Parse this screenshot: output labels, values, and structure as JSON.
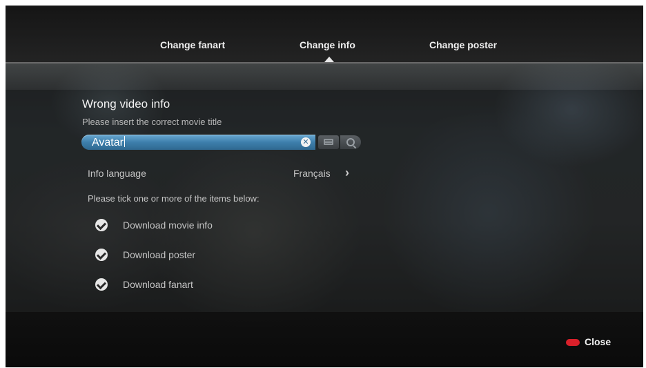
{
  "tabs": [
    {
      "label": "Change fanart",
      "active": false
    },
    {
      "label": "Change info",
      "active": true
    },
    {
      "label": "Change poster",
      "active": false
    }
  ],
  "dialog": {
    "title": "Wrong video info",
    "subtitle": "Please insert the correct movie title",
    "search": {
      "value": "Avatar"
    },
    "info_language": {
      "label": "Info language",
      "value": "Français"
    },
    "instruction": "Please tick one or more of the items below:",
    "options": [
      {
        "label": "Download movie info",
        "checked": true
      },
      {
        "label": "Download poster",
        "checked": true
      },
      {
        "label": "Download fanart",
        "checked": true
      }
    ]
  },
  "footer": {
    "close_label": "Close",
    "close_key_color": "#d9202a"
  },
  "colors": {
    "accent": "#3e7fac"
  }
}
